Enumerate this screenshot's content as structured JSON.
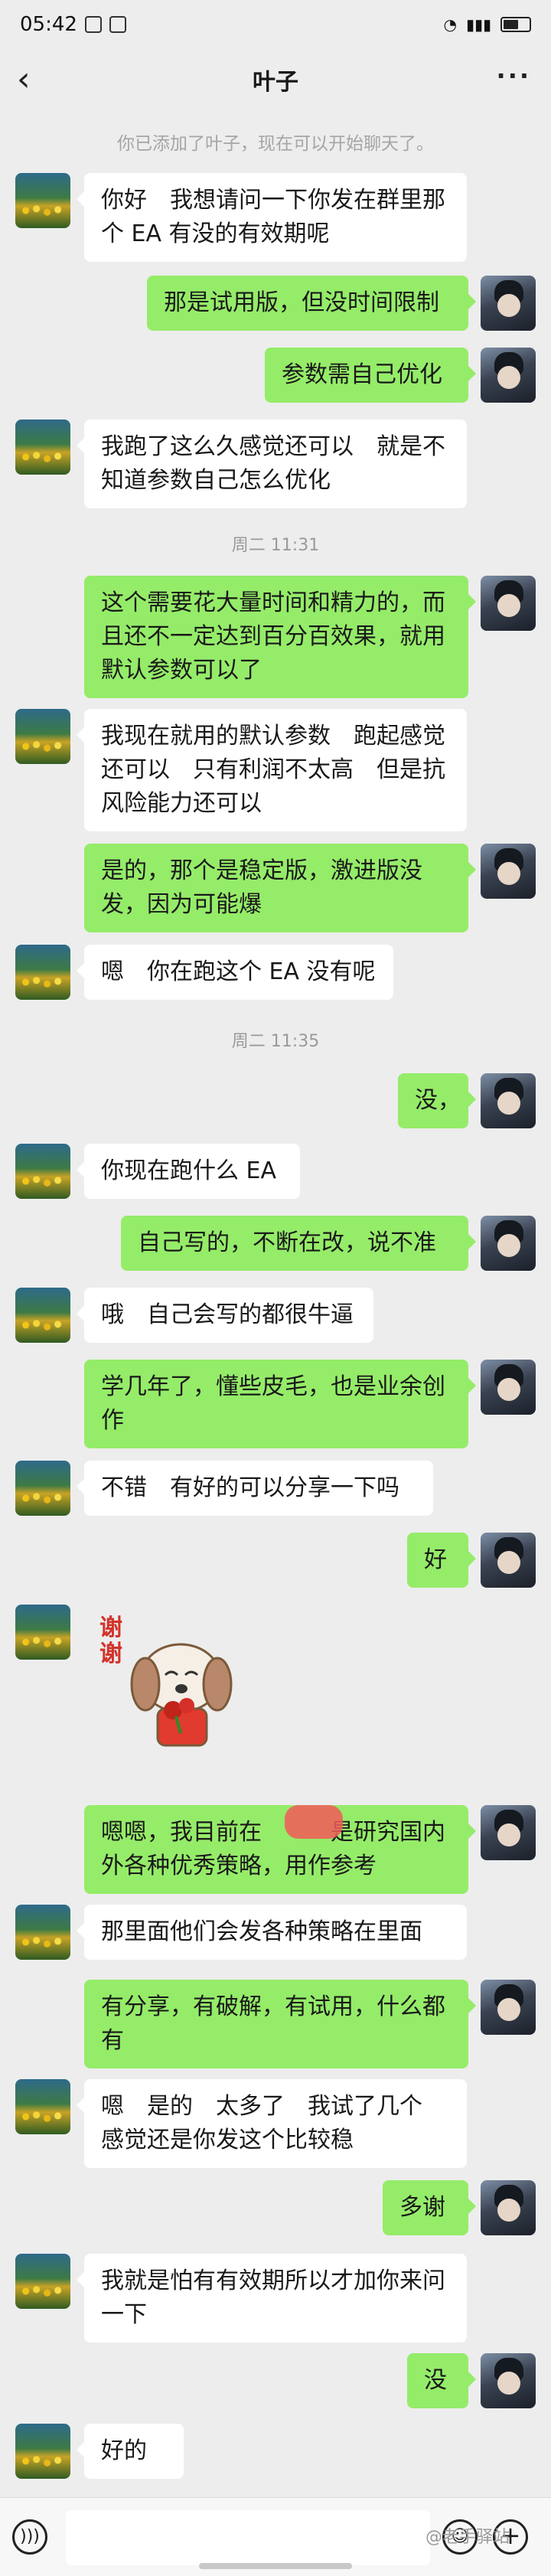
{
  "status": {
    "time": "05:42",
    "battery": "60%"
  },
  "header": {
    "title": "叶子",
    "back_icon": "chevron-left-icon",
    "more_icon": "more-icon",
    "more_glyph": "···",
    "back_glyph": "‹"
  },
  "system_message": "你已添加了叶子，现在可以开始聊天了。",
  "times": [
    "周二 11:31",
    "周二 11:35"
  ],
  "messages": [
    "你好　我想请问一下你发在群里那个 EA 有没的有效期呢",
    "那是试用版，但没时间限制",
    "参数需自己优化",
    "我跑了这么久感觉还可以　就是不知道参数自己怎么优化",
    "这个需要花大量时间和精力的，而且还不一定达到百分百效果，就用默认参数可以了",
    "我现在就用的默认参数　跑起感觉还可以　只有利润不太高　但是抗风险能力还可以",
    "是的，那个是稳定版，激进版没发，因为可能爆",
    "嗯　你在跑这个 EA 没有呢",
    "没，",
    "你现在跑什么 EA",
    "自己写的，不断在改，说不准",
    "哦　自己会写的都很牛逼",
    "学几年了，懂些皮毛，也是业余创作",
    "不错　有好的可以分享一下吗",
    "好",
    "嗯嗯，我目前在　　　是研究国内外各种优秀策略，用作参考",
    "那里面他们会发各种策略在里面",
    "有分享，有破解，有试用，什么都有",
    "嗯　是的　太多了　我试了几个　感觉还是你发这个比较稳",
    "多谢",
    "我就是怕有有效期所以才加你来问一下",
    "没",
    "好的"
  ],
  "sticker": {
    "text": "谢谢",
    "icon": "puppy-sticker-icon"
  },
  "input_bar": {
    "voice_icon": "voice-icon",
    "emoji_icon": "emoji-icon",
    "plus_icon": "plus-icon",
    "voice_glyph": ")))",
    "emoji_glyph": "☺",
    "plus_glyph": "+"
  },
  "watermark": "@老手驿站"
}
